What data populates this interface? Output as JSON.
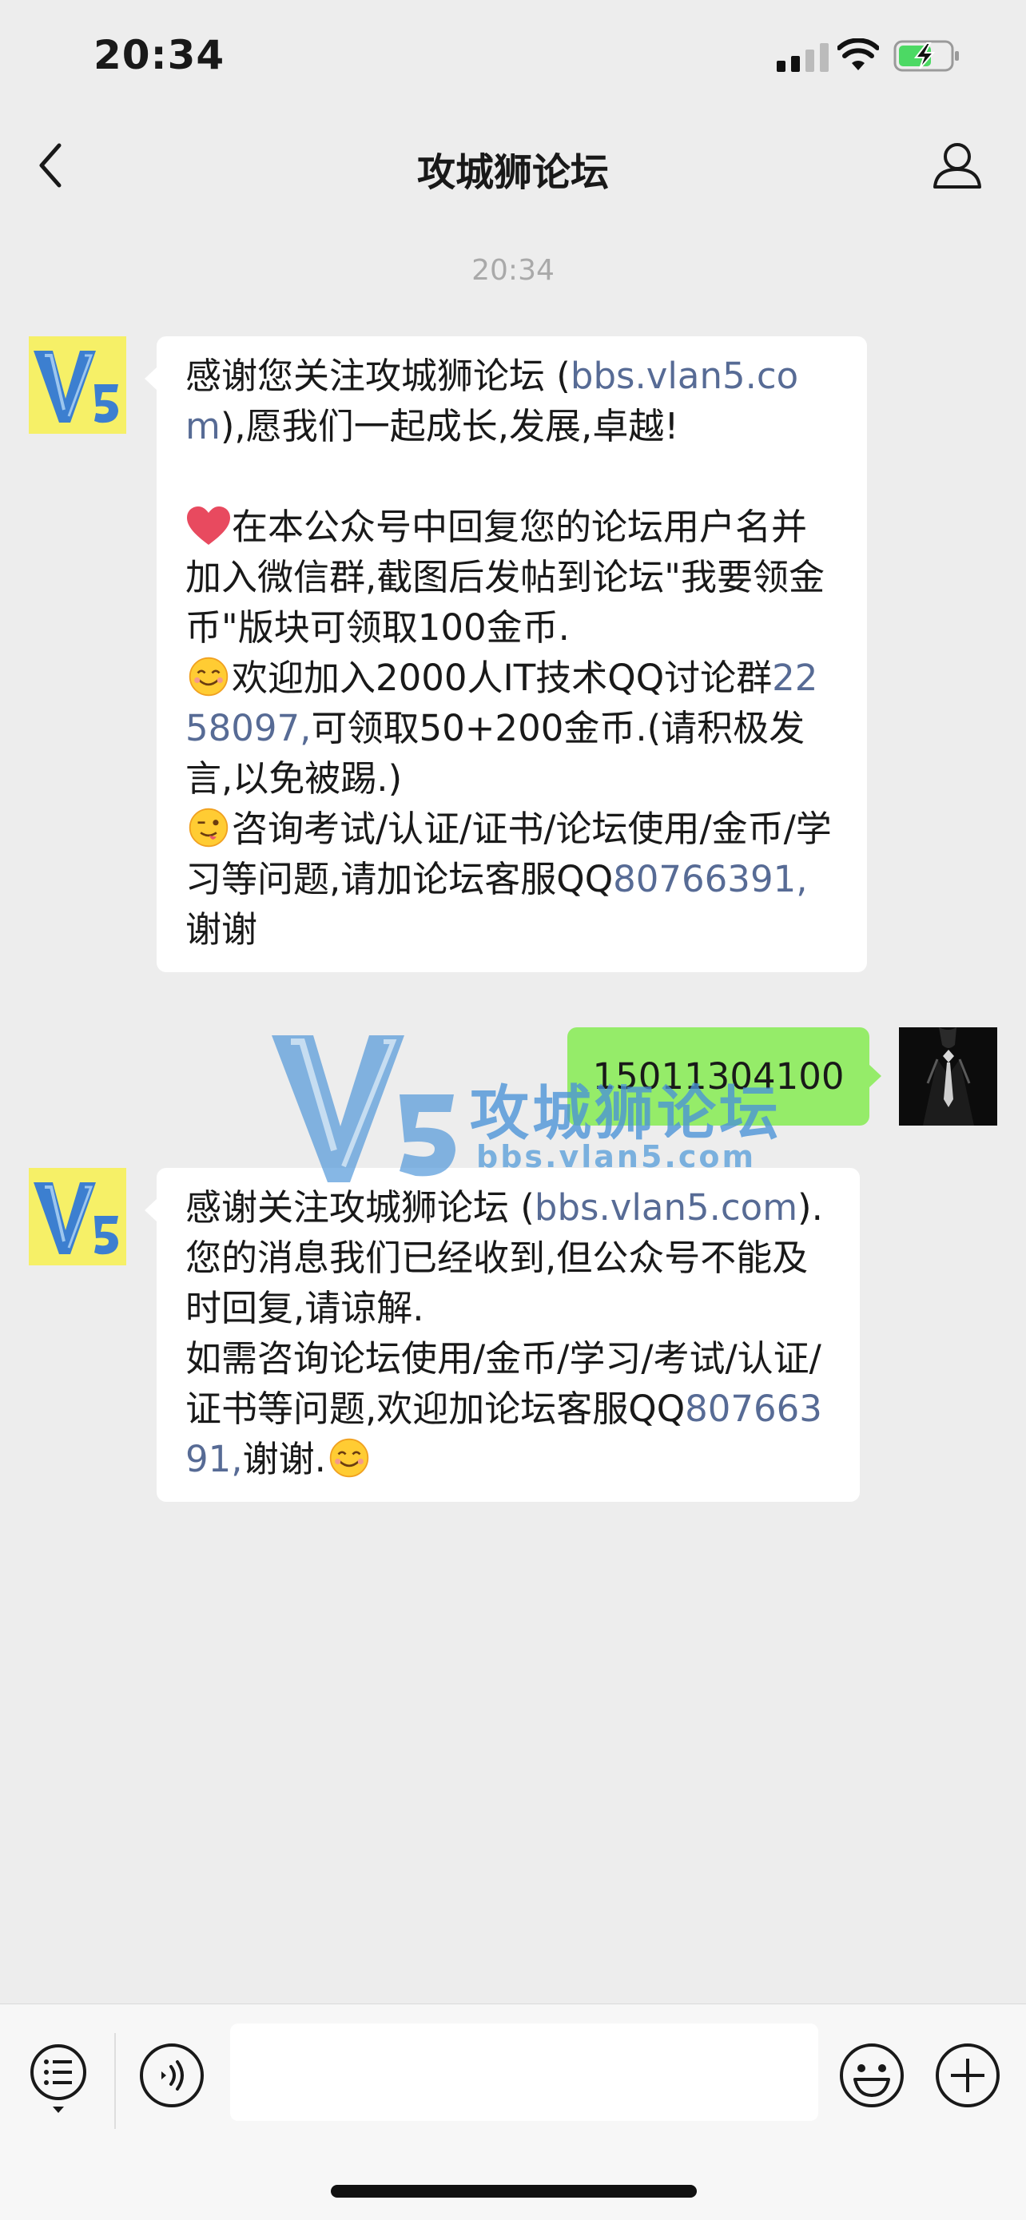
{
  "status_bar": {
    "time": "20:34"
  },
  "nav": {
    "title": "攻城狮论坛"
  },
  "chat": {
    "timestamp": "20:34",
    "incoming_1": {
      "line1_text": "感谢您关注攻城狮论坛 (",
      "line1_link": "bbs.vlan5.com",
      "line1_rest": "),愿我们一起成长,发展,卓越!",
      "para2": "在本公众号中回复您的论坛用户名并加入微信群,截图后发帖到论坛\"我要领金币\"版块可领取100金币.",
      "para3_text": "欢迎加入2000人IT技术QQ讨论群",
      "para3_link": "2258097,",
      "para3_rest": "可领取50+200金币.(请积极发言,以免被踢.)",
      "para4_text": "咨询考试/认证/证书/论坛使用/金币/学习等问题,请加论坛客服QQ",
      "para4_link": "80766391,",
      "para4_rest": "谢谢"
    },
    "outgoing_1": {
      "text": "15011304100"
    },
    "incoming_2": {
      "line1_text": "感谢关注攻城狮论坛 (",
      "line1_link": "bbs.vlan5.com",
      "line1_rest": ").",
      "para2": "您的消息我们已经收到,但公众号不能及时回复,请谅解.",
      "para3_text": "如需咨询论坛使用/金币/学习/考试/认证/证书等问题,欢迎加论坛客服QQ",
      "para3_link": "80766391,",
      "para3_rest": "谢谢."
    }
  },
  "watermark": {
    "title": "攻城狮论坛",
    "url": "bbs.vlan5.com"
  },
  "icons": [
    "back-icon",
    "profile-icon",
    "heart-emoji",
    "smile-emoji",
    "wink-emoji",
    "menu-list-icon",
    "voice-icon",
    "emoji-icon",
    "plus-icon"
  ],
  "colors": {
    "background": "#ededed",
    "incoming_bubble": "#ffffff",
    "outgoing_bubble": "#95ec69",
    "link": "#576b95",
    "avatar_bg": "#f6f067"
  }
}
